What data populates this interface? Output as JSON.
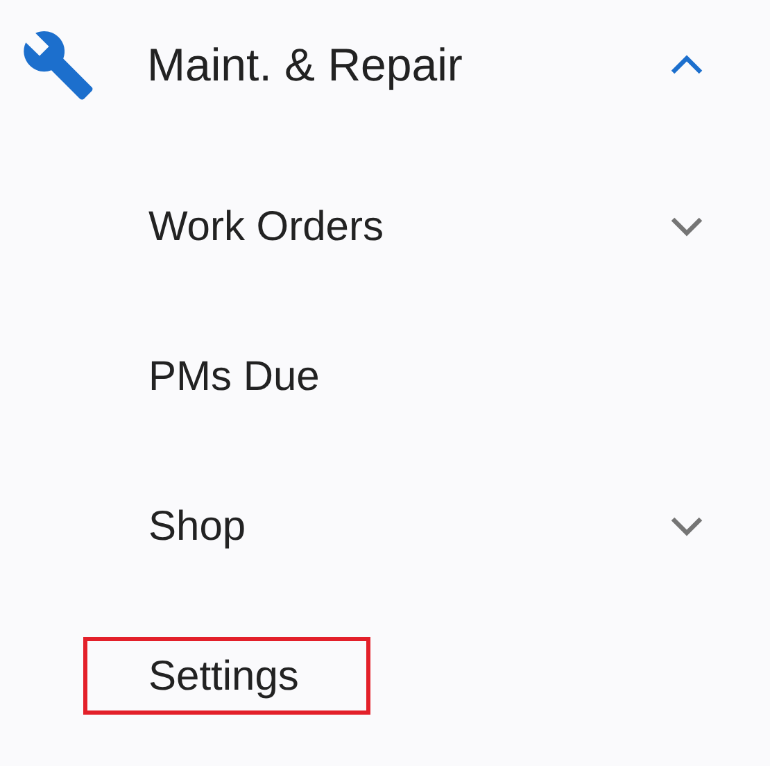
{
  "menu": {
    "label": "Maint. & Repair",
    "expanded": true,
    "children": [
      {
        "label": "Work Orders",
        "expandable": true,
        "expanded": false,
        "highlighted": false
      },
      {
        "label": "PMs Due",
        "expandable": false,
        "highlighted": false
      },
      {
        "label": "Shop",
        "expandable": true,
        "expanded": false,
        "highlighted": false
      },
      {
        "label": "Settings",
        "expandable": false,
        "highlighted": true
      }
    ]
  }
}
